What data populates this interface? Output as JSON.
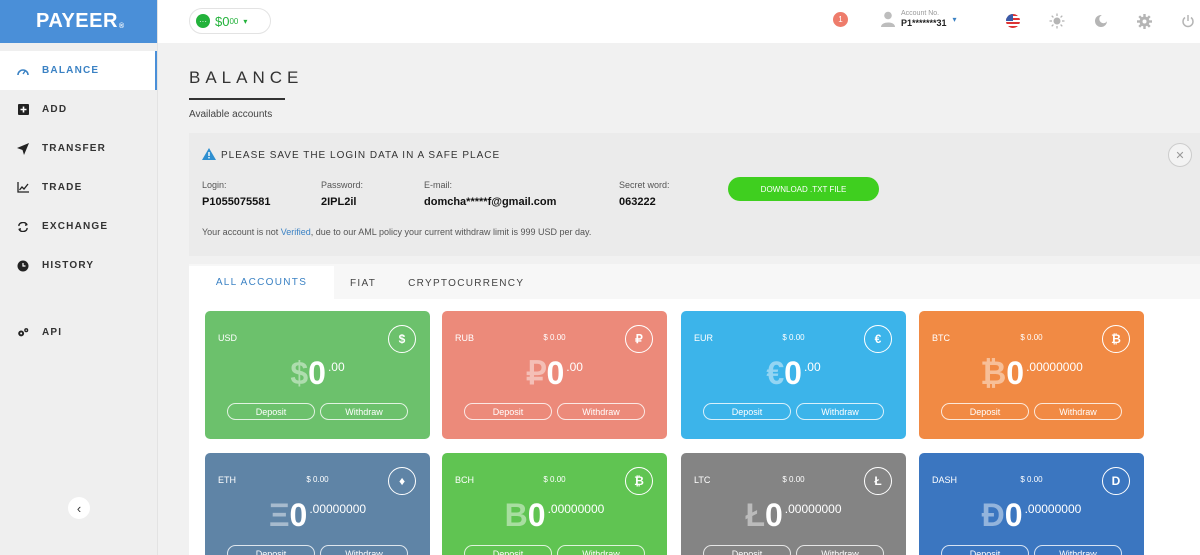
{
  "brand": {
    "logo_text": "PAYEER",
    "logo_mark": "®"
  },
  "sidebar": {
    "items": [
      {
        "label": "BALANCE",
        "icon": "gauge-icon",
        "active": true
      },
      {
        "label": "ADD",
        "icon": "plus-square-icon"
      },
      {
        "label": "TRANSFER",
        "icon": "paper-plane-icon"
      },
      {
        "label": "TRADE",
        "icon": "chart-icon"
      },
      {
        "label": "EXCHANGE",
        "icon": "exchange-icon"
      },
      {
        "label": "HISTORY",
        "icon": "clock-icon"
      },
      {
        "label": "API",
        "icon": "gears-icon"
      }
    ],
    "collapse_icon": "chevron-left-icon"
  },
  "topbar": {
    "balance": {
      "amount": "$0",
      "cents": "00",
      "caret": "▾"
    },
    "notifications_count": "1",
    "account": {
      "label": "Account No.",
      "number": "P1*******31",
      "caret": "▾"
    },
    "icons": [
      "us-flag-icon",
      "sun-icon",
      "moon-icon",
      "gear-icon",
      "power-icon"
    ]
  },
  "page": {
    "title": "BALANCE",
    "subtitle": "Available accounts"
  },
  "notice": {
    "heading": "PLEASE SAVE THE LOGIN DATA IN A SAFE PLACE",
    "login_label": "Login:",
    "login_value": "P1055075581",
    "password_label": "Password:",
    "password_value": "2IPL2il",
    "email_label": "E-mail:",
    "email_value": "domcha*****f@gmail.com",
    "secret_label": "Secret word:",
    "secret_value": "063222",
    "download_button": "DOWNLOAD .TXT FILE",
    "aml_before": "Your account is not ",
    "aml_link": "Verified",
    "aml_after": ", due to our AML policy your current withdraw limit is 999 USD per day.",
    "close_icon": "close-icon"
  },
  "tabs": [
    "ALL ACCOUNTS",
    "FIAT",
    "CRYPTOCURRENCY"
  ],
  "cards": [
    {
      "code": "USD",
      "sub": "",
      "icon": "$",
      "symbol": "$",
      "amount": "0",
      "decimals": ".00",
      "color": "#6cc16c",
      "deposit": "Deposit",
      "withdraw": "Withdraw"
    },
    {
      "code": "RUB",
      "sub": "$ 0.00",
      "icon": "₽",
      "symbol": "₽",
      "amount": "0",
      "decimals": ".00",
      "color": "#ec8a7a",
      "deposit": "Deposit",
      "withdraw": "Withdraw"
    },
    {
      "code": "EUR",
      "sub": "$ 0.00",
      "icon": "€",
      "symbol": "€",
      "amount": "0",
      "decimals": ".00",
      "color": "#3cb4ea",
      "deposit": "Deposit",
      "withdraw": "Withdraw"
    },
    {
      "code": "BTC",
      "sub": "$ 0.00",
      "icon": "₿",
      "symbol": "₿",
      "amount": "0",
      "decimals": ".00000000",
      "color": "#f18a44",
      "deposit": "Deposit",
      "withdraw": "Withdraw"
    },
    {
      "code": "ETH",
      "sub": "$ 0.00",
      "icon": "♦",
      "symbol": "Ξ",
      "amount": "0",
      "decimals": ".00000000",
      "color": "#5f84a6",
      "deposit": "Deposit",
      "withdraw": "Withdraw"
    },
    {
      "code": "BCH",
      "sub": "$ 0.00",
      "icon": "₿",
      "symbol": "B",
      "amount": "0",
      "decimals": ".00000000",
      "color": "#60c452",
      "deposit": "Deposit",
      "withdraw": "Withdraw"
    },
    {
      "code": "LTC",
      "sub": "$ 0.00",
      "icon": "Ł",
      "symbol": "Ł",
      "amount": "0",
      "decimals": ".00000000",
      "color": "#848484",
      "deposit": "Deposit",
      "withdraw": "Withdraw"
    },
    {
      "code": "DASH",
      "sub": "$ 0.00",
      "icon": "D",
      "symbol": "Đ",
      "amount": "0",
      "decimals": ".00000000",
      "color": "#3b76c0",
      "deposit": "Deposit",
      "withdraw": "Withdraw"
    }
  ]
}
